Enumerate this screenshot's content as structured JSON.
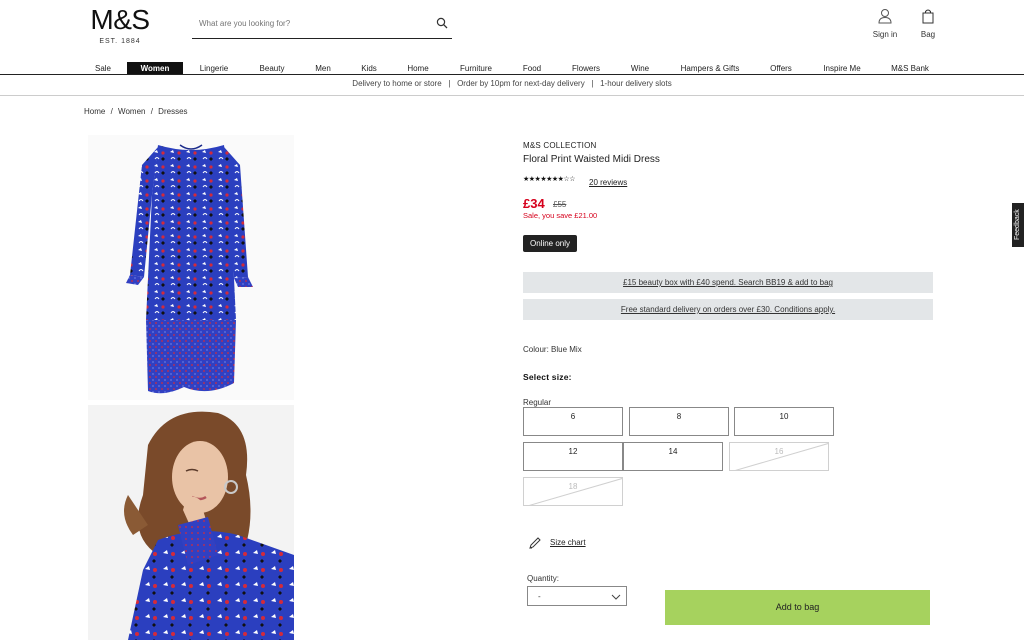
{
  "header": {
    "logo": "M&S",
    "est": "EST. 1884",
    "search_placeholder": "What are you looking for?",
    "sign_in": "Sign in",
    "bag": "Bag"
  },
  "nav": {
    "items": [
      "Sale",
      "Women",
      "Lingerie",
      "Beauty",
      "Men",
      "Kids",
      "Home",
      "Furniture",
      "Food",
      "Flowers",
      "Wine",
      "Hampers & Gifts",
      "Offers",
      "Inspire Me",
      "M&S Bank"
    ],
    "active": "Women"
  },
  "delivery_bar": "Delivery to home or store   |   Order by 10pm for next-day delivery   |   1-hour delivery slots",
  "breadcrumb": [
    "Home",
    "/",
    "Women",
    "/",
    "Dresses"
  ],
  "product": {
    "brand": "M&S COLLECTION",
    "title": "Floral Print Waisted Midi Dress",
    "rating_stars": "★★★★★★★☆☆",
    "rating_value": 0.75,
    "reviews": "20 reviews",
    "price": "£34",
    "was_price": "£55",
    "saving": "Sale, you save £21.00",
    "badge": "Online only",
    "promos": [
      "£15 beauty box with £40 spend. Search BB19 & add to bag",
      "Free standard delivery on orders over £30. Conditions apply."
    ],
    "colour_label": "Colour:",
    "colour_value": "Blue Mix",
    "select_size": "Select size:",
    "fit": "Regular",
    "sizes": [
      {
        "label": "6",
        "available": true
      },
      {
        "label": "8",
        "available": true
      },
      {
        "label": "10",
        "available": true
      },
      {
        "label": "12",
        "available": true
      },
      {
        "label": "14",
        "available": true
      },
      {
        "label": "16",
        "available": false
      },
      {
        "label": "18",
        "available": false
      }
    ],
    "size_chart": "Size chart",
    "quantity_label": "Quantity:",
    "quantity_value": "-",
    "add_to_bag": "Add to bag"
  },
  "feedback_tab": "Feedback",
  "colors": {
    "accent_red": "#d6001c",
    "add_bag_green": "#a6d25e",
    "promo_bg": "#e3e6e8",
    "dress_blue": "#2b3fbf"
  }
}
